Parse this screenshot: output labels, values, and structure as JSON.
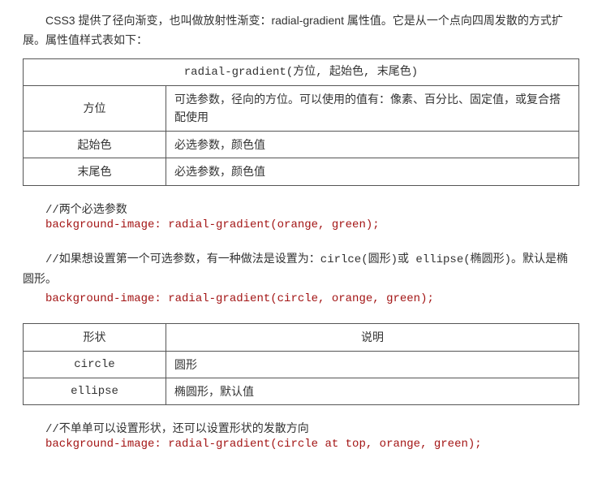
{
  "intro": "CSS3 提供了径向渐变，也叫做放射性渐变：radial-gradient 属性值。它是从一个点向四周发散的方式扩展。属性值样式表如下：",
  "table1": {
    "header": "radial-gradient(方位, 起始色, 末尾色)",
    "rows": [
      {
        "name": "方位",
        "desc": "可选参数，径向的方位。可以使用的值有：像素、百分比、固定值，或复合搭配使用"
      },
      {
        "name": "起始色",
        "desc": "必选参数，颜色值"
      },
      {
        "name": "末尾色",
        "desc": "必选参数，颜色值"
      }
    ]
  },
  "block1": {
    "comment": "//两个必选参数",
    "code": "background-image: radial-gradient(orange, green);"
  },
  "block2": {
    "comment": "//如果想设置第一个可选参数，有一种做法是设置为：cirlce(圆形)或 ellipse(椭圆形)。默认是椭圆形。",
    "code": "background-image: radial-gradient(circle, orange, green);"
  },
  "table2": {
    "headers": {
      "col1": "形状",
      "col2": "说明"
    },
    "rows": [
      {
        "name": "circle",
        "desc": "圆形"
      },
      {
        "name": "ellipse",
        "desc": "椭圆形，默认值"
      }
    ]
  },
  "block3": {
    "comment": "//不单单可以设置形状，还可以设置形状的发散方向",
    "code": "background-image: radial-gradient(circle at top, orange, green);"
  }
}
